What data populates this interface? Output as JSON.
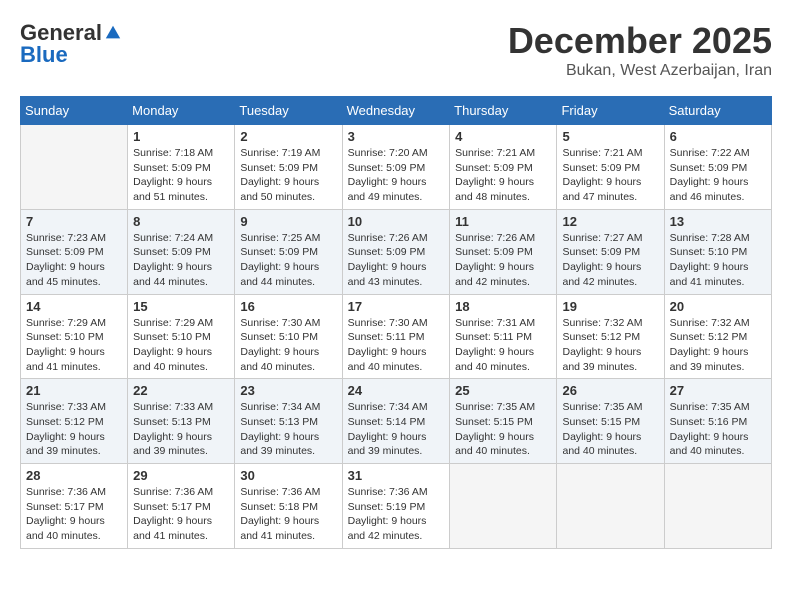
{
  "logo": {
    "general": "General",
    "blue": "Blue"
  },
  "header": {
    "month": "December 2025",
    "location": "Bukan, West Azerbaijan, Iran"
  },
  "days_of_week": [
    "Sunday",
    "Monday",
    "Tuesday",
    "Wednesday",
    "Thursday",
    "Friday",
    "Saturday"
  ],
  "weeks": [
    [
      {
        "day": "",
        "info": ""
      },
      {
        "day": "1",
        "info": "Sunrise: 7:18 AM\nSunset: 5:09 PM\nDaylight: 9 hours\nand 51 minutes."
      },
      {
        "day": "2",
        "info": "Sunrise: 7:19 AM\nSunset: 5:09 PM\nDaylight: 9 hours\nand 50 minutes."
      },
      {
        "day": "3",
        "info": "Sunrise: 7:20 AM\nSunset: 5:09 PM\nDaylight: 9 hours\nand 49 minutes."
      },
      {
        "day": "4",
        "info": "Sunrise: 7:21 AM\nSunset: 5:09 PM\nDaylight: 9 hours\nand 48 minutes."
      },
      {
        "day": "5",
        "info": "Sunrise: 7:21 AM\nSunset: 5:09 PM\nDaylight: 9 hours\nand 47 minutes."
      },
      {
        "day": "6",
        "info": "Sunrise: 7:22 AM\nSunset: 5:09 PM\nDaylight: 9 hours\nand 46 minutes."
      }
    ],
    [
      {
        "day": "7",
        "info": "Sunrise: 7:23 AM\nSunset: 5:09 PM\nDaylight: 9 hours\nand 45 minutes."
      },
      {
        "day": "8",
        "info": "Sunrise: 7:24 AM\nSunset: 5:09 PM\nDaylight: 9 hours\nand 44 minutes."
      },
      {
        "day": "9",
        "info": "Sunrise: 7:25 AM\nSunset: 5:09 PM\nDaylight: 9 hours\nand 44 minutes."
      },
      {
        "day": "10",
        "info": "Sunrise: 7:26 AM\nSunset: 5:09 PM\nDaylight: 9 hours\nand 43 minutes."
      },
      {
        "day": "11",
        "info": "Sunrise: 7:26 AM\nSunset: 5:09 PM\nDaylight: 9 hours\nand 42 minutes."
      },
      {
        "day": "12",
        "info": "Sunrise: 7:27 AM\nSunset: 5:09 PM\nDaylight: 9 hours\nand 42 minutes."
      },
      {
        "day": "13",
        "info": "Sunrise: 7:28 AM\nSunset: 5:10 PM\nDaylight: 9 hours\nand 41 minutes."
      }
    ],
    [
      {
        "day": "14",
        "info": "Sunrise: 7:29 AM\nSunset: 5:10 PM\nDaylight: 9 hours\nand 41 minutes."
      },
      {
        "day": "15",
        "info": "Sunrise: 7:29 AM\nSunset: 5:10 PM\nDaylight: 9 hours\nand 40 minutes."
      },
      {
        "day": "16",
        "info": "Sunrise: 7:30 AM\nSunset: 5:10 PM\nDaylight: 9 hours\nand 40 minutes."
      },
      {
        "day": "17",
        "info": "Sunrise: 7:30 AM\nSunset: 5:11 PM\nDaylight: 9 hours\nand 40 minutes."
      },
      {
        "day": "18",
        "info": "Sunrise: 7:31 AM\nSunset: 5:11 PM\nDaylight: 9 hours\nand 40 minutes."
      },
      {
        "day": "19",
        "info": "Sunrise: 7:32 AM\nSunset: 5:12 PM\nDaylight: 9 hours\nand 39 minutes."
      },
      {
        "day": "20",
        "info": "Sunrise: 7:32 AM\nSunset: 5:12 PM\nDaylight: 9 hours\nand 39 minutes."
      }
    ],
    [
      {
        "day": "21",
        "info": "Sunrise: 7:33 AM\nSunset: 5:12 PM\nDaylight: 9 hours\nand 39 minutes."
      },
      {
        "day": "22",
        "info": "Sunrise: 7:33 AM\nSunset: 5:13 PM\nDaylight: 9 hours\nand 39 minutes."
      },
      {
        "day": "23",
        "info": "Sunrise: 7:34 AM\nSunset: 5:13 PM\nDaylight: 9 hours\nand 39 minutes."
      },
      {
        "day": "24",
        "info": "Sunrise: 7:34 AM\nSunset: 5:14 PM\nDaylight: 9 hours\nand 39 minutes."
      },
      {
        "day": "25",
        "info": "Sunrise: 7:35 AM\nSunset: 5:15 PM\nDaylight: 9 hours\nand 40 minutes."
      },
      {
        "day": "26",
        "info": "Sunrise: 7:35 AM\nSunset: 5:15 PM\nDaylight: 9 hours\nand 40 minutes."
      },
      {
        "day": "27",
        "info": "Sunrise: 7:35 AM\nSunset: 5:16 PM\nDaylight: 9 hours\nand 40 minutes."
      }
    ],
    [
      {
        "day": "28",
        "info": "Sunrise: 7:36 AM\nSunset: 5:17 PM\nDaylight: 9 hours\nand 40 minutes."
      },
      {
        "day": "29",
        "info": "Sunrise: 7:36 AM\nSunset: 5:17 PM\nDaylight: 9 hours\nand 41 minutes."
      },
      {
        "day": "30",
        "info": "Sunrise: 7:36 AM\nSunset: 5:18 PM\nDaylight: 9 hours\nand 41 minutes."
      },
      {
        "day": "31",
        "info": "Sunrise: 7:36 AM\nSunset: 5:19 PM\nDaylight: 9 hours\nand 42 minutes."
      },
      {
        "day": "",
        "info": ""
      },
      {
        "day": "",
        "info": ""
      },
      {
        "day": "",
        "info": ""
      }
    ]
  ]
}
